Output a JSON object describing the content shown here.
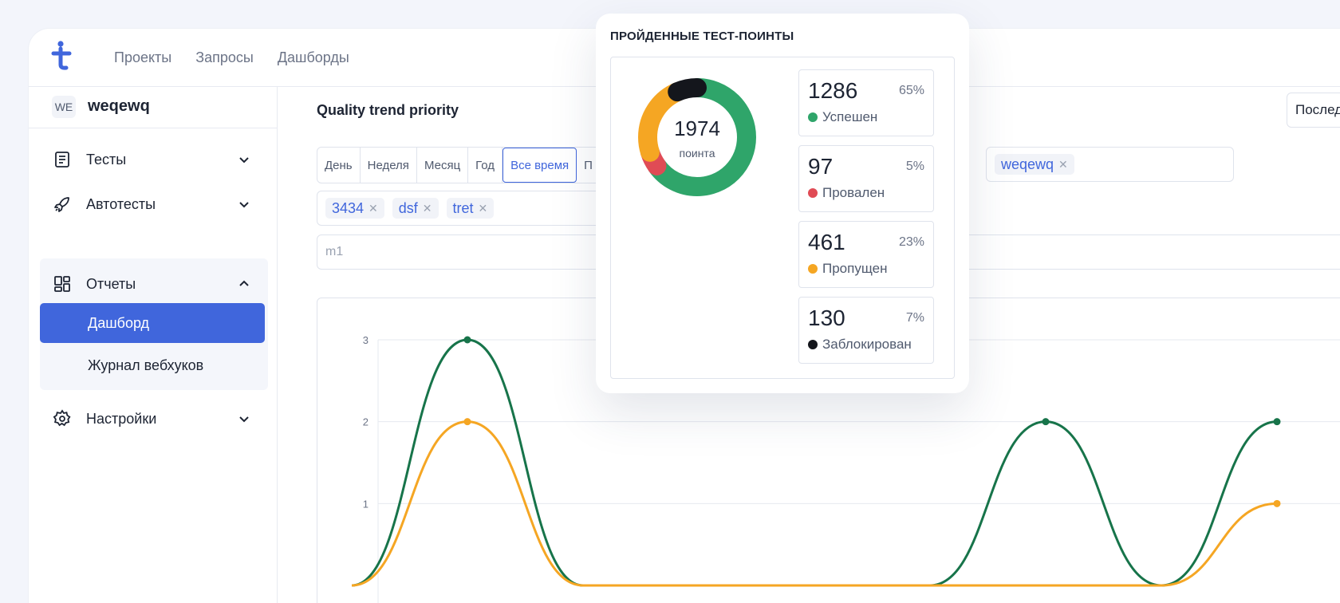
{
  "nav": {
    "items": [
      "Проекты",
      "Запросы",
      "Дашборды"
    ]
  },
  "workspace": {
    "badge": "WE",
    "name": "weqewq"
  },
  "sidebar": {
    "items": [
      {
        "label": "Тесты",
        "icon": "document-list-icon"
      },
      {
        "label": "Автотесты",
        "icon": "rocket-icon"
      },
      {
        "label": "Отчеты",
        "icon": "dashboard-grid-icon"
      },
      {
        "label": "Настройки",
        "icon": "gear-icon"
      }
    ],
    "sub_items": [
      "Дашборд",
      "Журнал вебхуков"
    ]
  },
  "main": {
    "title": "Quality trend priority",
    "period_select": "Послед",
    "time_ranges": [
      "День",
      "Неделя",
      "Месяц",
      "Год",
      "Все время"
    ],
    "time_range_cut": "П",
    "selected_range": "Все время",
    "project_chips": [
      "weqewq"
    ],
    "tag_chips": [
      "3434",
      "dsf",
      "tret"
    ],
    "milestone_placeholder": "m1"
  },
  "popup": {
    "title": "ПРОЙДЕННЫЕ ТЕСТ-ПОИНТЫ",
    "total": "1974",
    "unit": "поинта",
    "stats": [
      {
        "value": "1286",
        "percent": "65%",
        "label": "Успешен",
        "color": "#2fa56a"
      },
      {
        "value": "97",
        "percent": "5%",
        "label": "Провален",
        "color": "#e04b55"
      },
      {
        "value": "461",
        "percent": "23%",
        "label": "Пропущен",
        "color": "#f5a623"
      },
      {
        "value": "130",
        "percent": "7%",
        "label": "Заблокирован",
        "color": "#14161c"
      }
    ]
  },
  "chart_data": {
    "type": "line",
    "yticks": [
      "1",
      "2",
      "3"
    ],
    "ylim": [
      0,
      3
    ],
    "x": [
      0,
      1,
      2,
      3,
      4,
      5,
      6,
      7,
      8
    ],
    "series": [
      {
        "color": "#17744a",
        "values": [
          0,
          3,
          0,
          0,
          0,
          0,
          2,
          0,
          2
        ]
      },
      {
        "color": "#f5a623",
        "values": [
          0,
          2,
          0,
          0,
          0,
          0,
          0,
          0,
          1
        ]
      }
    ],
    "grid": true
  },
  "colors": {
    "accent": "#4066dc",
    "border": "#dfe3ec"
  }
}
